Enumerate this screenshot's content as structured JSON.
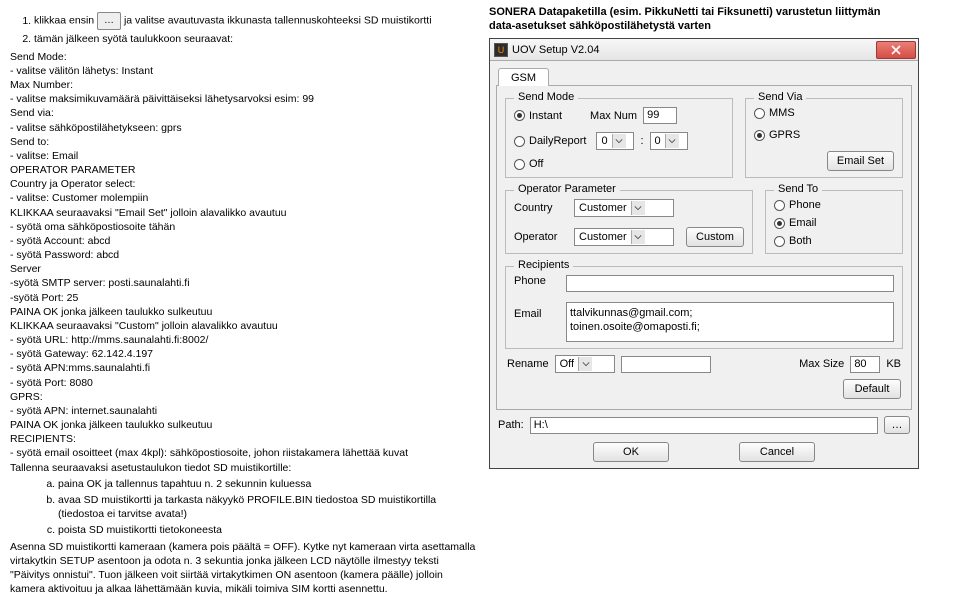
{
  "header": {
    "title1": "SONERA Datapaketilla (esim. PikkuNetti tai Fiksunetti) varustetun liittymän",
    "title2": "data-asetukset sähköpostilähetystä varten"
  },
  "left": {
    "step1a": "klikkaa ensin",
    "step1_btn": "…",
    "step1b": "ja valitse avautuvasta ikkunasta tallennuskohteeksi SD muistikortti",
    "step2": "tämän jälkeen syötä taulukkoon seuraavat:",
    "l01": "Send Mode:",
    "l02": "- valitse välitön lähetys: Instant",
    "l03": "Max Number:",
    "l04": "- valitse maksimikuvamäärä päivittäiseksi lähetysarvoksi esim: 99",
    "l05": "Send via:",
    "l06": "- valitse sähköpostilähetykseen: gprs",
    "l07": "Send to:",
    "l08": "- valitse: Email",
    "l09": "OPERATOR PARAMETER",
    "l10": "Country ja Operator select:",
    "l11": "- valitse: Customer molempiin",
    "l12": "KLIKKAA seuraavaksi \"Email Set\" jolloin alavalikko avautuu",
    "l13": "- syötä oma sähköpostiosoite tähän",
    "l14": "- syötä Account: abcd",
    "l15": "- syötä Password: abcd",
    "l16": "Server",
    "l17": "-syötä SMTP server: posti.saunalahti.fi",
    "l18": "-syötä Port: 25",
    "l19": "PAINA OK jonka jälkeen taulukko sulkeutuu",
    "l20": "KLIKKAA seuraavaksi \"Custom\" jolloin alavalikko avautuu",
    "l21": "- syötä URL: http://mms.saunalahti.fi:8002/",
    "l22": "- syötä Gateway: 62.142.4.197",
    "l23": "- syötä APN:mms.saunalahti.fi",
    "l24": "- syötä Port: 8080",
    "l25": "GPRS:",
    "l26": "- syötä APN: internet.saunalahti",
    "l27": "PAINA OK jonka jälkeen taulukko sulkeutuu",
    "l28": "RECIPIENTS:",
    "l29": "- syötä email osoitteet (max 4kpl): sähköpostiosoite, johon riistakamera lähettää kuvat",
    "l30": "Tallenna seuraavaksi asetustaulukon tiedot SD muistikortille:",
    "sa": "paina OK ja tallennus tapahtuu n. 2 sekunnin kuluessa",
    "sb": "avaa SD muistikortti ja tarkasta näkyykö PROFILE.BIN tiedostoa SD muistikortilla (tiedostoa ei tarvitse avata!)",
    "sc": "poista SD muistikortti tietokoneesta",
    "l31": "Asenna SD muistikortti kameraan (kamera pois päältä = OFF). Kytke nyt kameraan virta asettamalla virtakytkin SETUP asentoon ja odota n. 3 sekuntia jonka jälkeen LCD näytölle ilmestyy teksti \"Päivitys onnistui\". Tuon jälkeen voit siirtää virtakytkimen ON asentoon (kamera päälle) jolloin kamera aktivoituu ja alkaa lähettämään kuvia, mikäli toimiva SIM kortti asennettu."
  },
  "win": {
    "title": "UOV Setup V2.04",
    "tab_gsm": "GSM",
    "g_sendmode": "Send Mode",
    "g_sendvia": "Send Via",
    "r_instant": "Instant",
    "r_daily": "DailyReport",
    "r_off": "Off",
    "maxnum_lbl": "Max Num",
    "maxnum_val": "99",
    "daily_h": "0",
    "daily_sep": ":",
    "daily_m": "0",
    "r_mms": "MMS",
    "r_gprs": "GPRS",
    "btn_emailset": "Email Set",
    "g_opparam": "Operator Parameter",
    "g_sendto": "Send To",
    "lbl_country": "Country",
    "lbl_operator": "Operator",
    "dd_customer": "Customer",
    "btn_custom": "Custom",
    "r_phone": "Phone",
    "r_email": "Email",
    "r_both": "Both",
    "g_recipients": "Recipients",
    "lbl_phone": "Phone",
    "lbl_email": "Email",
    "email_val": "ttalvikunnas@gmail.com;\ntoinen.osoite@omaposti.fi;",
    "lbl_rename": "Rename",
    "dd_off": "Off",
    "lbl_maxsize": "Max Size",
    "maxsize_val": "80",
    "kb": "KB",
    "btn_default": "Default",
    "lbl_path": "Path:",
    "path_val": "H:\\",
    "btn_browse": "…",
    "btn_ok": "OK",
    "btn_cancel": "Cancel"
  }
}
